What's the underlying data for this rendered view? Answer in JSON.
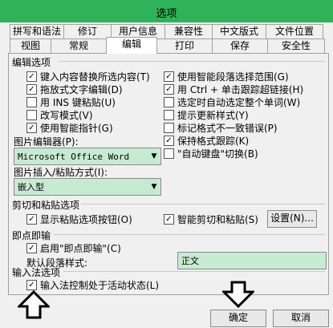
{
  "window": {
    "title": "选项"
  },
  "tabs_row1": [
    "拼写和语法",
    "修订",
    "用户信息",
    "兼容性",
    "中文版式",
    "文件位置"
  ],
  "tabs_row2": [
    "视图",
    "常规",
    "编辑",
    "打印",
    "保存",
    "安全性"
  ],
  "active_tab": "编辑",
  "edit_options": {
    "header": "编辑选项",
    "left": [
      {
        "label": "键入内容替换所选内容(T)",
        "checked": true
      },
      {
        "label": "拖放式文字编辑(D)",
        "checked": true
      },
      {
        "label": "用 INS 键粘贴(U)",
        "checked": false
      },
      {
        "label": "改写模式(V)",
        "checked": false
      },
      {
        "label": "使用智能指针(G)",
        "checked": true
      }
    ],
    "right": [
      {
        "label": "使用智能段落选择范围(G)",
        "checked": true
      },
      {
        "label": "用 Ctrl + 单击跟踪超链接(H)",
        "checked": true
      },
      {
        "label": "选定时自动选定整个单词(W)",
        "checked": false
      },
      {
        "label": "提示更新样式(Y)",
        "checked": false
      },
      {
        "label": "标记格式不一致错误(P)",
        "checked": false
      },
      {
        "label": "保持格式跟踪(K)",
        "checked": true
      },
      {
        "label": "\"自动键盘\"切换(B)",
        "checked": false
      }
    ],
    "picture_editor_label": "图片编辑器(P):",
    "picture_editor_value": "Microsoft Office Word",
    "insert_paste_label": "图片插入/粘贴方式(I):",
    "insert_paste_value": "嵌入型"
  },
  "cut_paste": {
    "header": "剪切和粘贴选项",
    "show_paste_buttons": {
      "label": "显示粘贴选项按钮(O)",
      "checked": true
    },
    "smart_cut_paste": {
      "label": "智能剪切和粘贴(S)",
      "checked": true
    },
    "settings_button": "设置(N)..."
  },
  "click_type": {
    "header": "即点即输",
    "enable": {
      "label": "启用\"即点即输\"(C)",
      "checked": true
    },
    "default_style_label": "默认段落样式:",
    "default_style_value": "正文"
  },
  "ime": {
    "header": "输入法选项",
    "active": {
      "label": "输入法控制处于活动状态(L)",
      "checked": true
    }
  },
  "buttons": {
    "ok": "确定",
    "cancel": "取消"
  }
}
